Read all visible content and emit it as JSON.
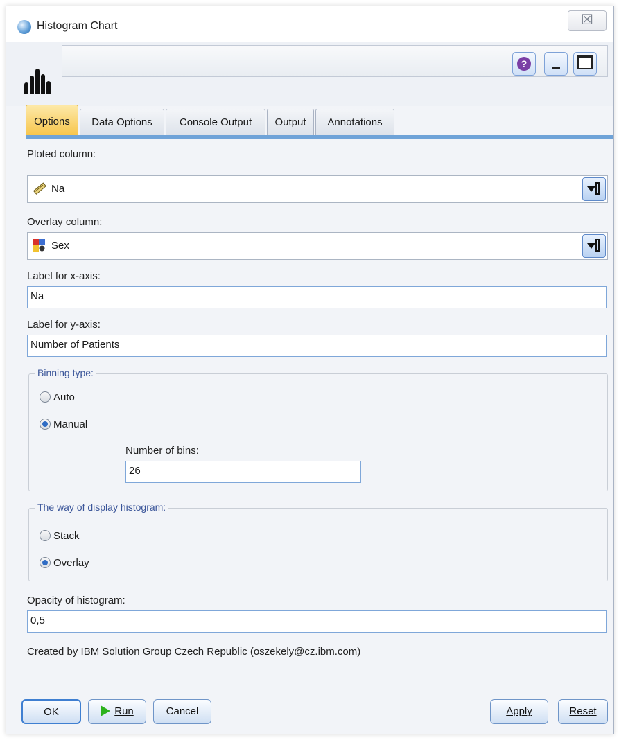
{
  "window": {
    "title": "Histogram Chart",
    "close_glyph": "☒"
  },
  "header": {
    "help_glyph": "?"
  },
  "tabs": [
    {
      "label": "Options"
    },
    {
      "label": "Data Options"
    },
    {
      "label": "Console Output"
    },
    {
      "label": "Output"
    },
    {
      "label": "Annotations"
    }
  ],
  "form": {
    "plotted_column_label": "Ploted column:",
    "plotted_column_value": "Na",
    "overlay_column_label": "Overlay column:",
    "overlay_column_value": "Sex",
    "x_label_caption": "Label for x-axis:",
    "x_label_value": "Na",
    "y_label_caption": "Label for y-axis:",
    "y_label_value": "Number of Patients",
    "binning_legend": "Binning type:",
    "binning_auto": "Auto",
    "binning_manual": "Manual",
    "bins_caption": "Number of bins:",
    "bins_value": "26",
    "display_legend": "The way of display histogram:",
    "display_stack": "Stack",
    "display_overlay": "Overlay",
    "opacity_caption": "Opacity of histogram:",
    "opacity_value": "0,5",
    "credit": "Created by IBM Solution Group Czech Republic (oszekely@cz.ibm.com)"
  },
  "buttons": {
    "ok": "OK",
    "run": "Run",
    "cancel": "Cancel",
    "apply": "Apply",
    "reset": "Reset"
  },
  "colors": {
    "active_tab": "#f7c54b",
    "tab_underline": "#6fa3d8",
    "run_icon": "#2bb21c"
  }
}
